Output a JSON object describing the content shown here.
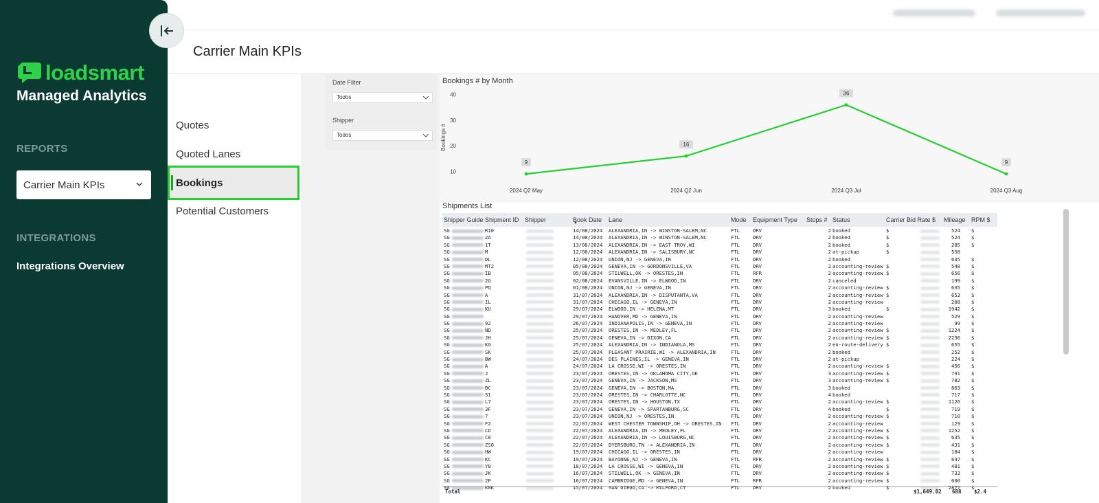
{
  "brand": {
    "name": "loadsmart",
    "subtitle": "Managed Analytics",
    "accent": "#2fd14a",
    "logo_icon": "loadsmart-logo-icon"
  },
  "sidebar": {
    "reports_title": "REPORTS",
    "selected_report": "Carrier Main KPIs",
    "integrations_title": "INTEGRATIONS",
    "integrations_link": "Integrations Overview",
    "collapse_icon": "collapse-left-icon"
  },
  "header": {
    "page_title": "Carrier Main KPIs"
  },
  "report_nav": {
    "items": [
      {
        "label": "Quotes",
        "active": false
      },
      {
        "label": "Quoted Lanes",
        "active": false
      },
      {
        "label": "Bookings",
        "active": true
      },
      {
        "label": "Potential Customers",
        "active": false
      }
    ]
  },
  "filters": {
    "date": {
      "label": "Date Filter",
      "value": "Todos"
    },
    "shipper": {
      "label": "Shipper",
      "value": "Todos"
    }
  },
  "chart_data": {
    "type": "line",
    "title": "Bookings # by Month",
    "ylabel": "Bookings #",
    "xlabel": "",
    "categories": [
      "2024 Q2 May",
      "2024 Q2 Jun",
      "2024 Q3 Jul",
      "2024 Q3 Aug"
    ],
    "values": [
      9,
      16,
      36,
      9
    ],
    "data_labels": [
      "9",
      "16",
      "36",
      "9"
    ],
    "yticks": [
      "10",
      "20",
      "30",
      "40"
    ],
    "ylim": [
      5,
      41
    ],
    "line_color": "#22d12f",
    "grid": false
  },
  "table": {
    "title": "Shipments List",
    "columns": [
      "Shipper Guide Shipment ID",
      "Shipper",
      "Book Date",
      "Lane",
      "Mode",
      "Equipment Type",
      "Stops #",
      "Status",
      "Carrier Bid Rate $",
      "Mileage",
      "RPM $"
    ],
    "rows": [
      [
        "SG",
        "R10",
        "14/08/2024",
        "ALEXANDRIA,IN -> WINSTON-SALEM,NC",
        "FTL",
        "DRV",
        "2",
        "booked",
        "$",
        "524",
        "$"
      ],
      [
        "SG",
        "2A",
        "14/08/2024",
        "ALEXANDRIA,IN -> WINSTON-SALEM,NC",
        "FTL",
        "DRV",
        "2",
        "booked",
        "$",
        "524",
        "$"
      ],
      [
        "SG",
        "1T",
        "13/08/2024",
        "ALEXANDRIA,IN -> EAST TROY,WI",
        "FTL",
        "DRV",
        "2",
        "booked",
        "$",
        "285",
        "$"
      ],
      [
        "SG",
        "M",
        "12/08/2024",
        "ALEXANDRIA,IN -> SALISBURY,NC",
        "FTL",
        "DRV",
        "2",
        "at-pickup",
        "$",
        "558",
        ""
      ],
      [
        "SG",
        "DL",
        "12/08/2024",
        "UNION,NJ -> GENEVA,IN",
        "FTL",
        "DRV",
        "2",
        "booked",
        "",
        "635",
        "$"
      ],
      [
        "SG",
        "MT2",
        "05/08/2024",
        "GENEVA,IN -> GORDONSVILLE,VA",
        "FTL",
        "DRV",
        "2",
        "accounting-review",
        "$",
        "548",
        "$"
      ],
      [
        "SG",
        "IB",
        "05/08/2024",
        "STILWELL,OK -> ORESTES,IN",
        "FTL",
        "RFR",
        "2",
        "accounting-review",
        "$",
        "656",
        "$"
      ],
      [
        "SG",
        "2G",
        "02/08/2024",
        "EVANSVILLE,IN -> ELWOOD,IN",
        "FTL",
        "DRV",
        "2",
        "canceled",
        "",
        "199",
        "$"
      ],
      [
        "SG",
        "PQ",
        "01/08/2024",
        "UNION,NJ -> GENEVA,IN",
        "FTL",
        "DRV",
        "2",
        "accounting-review",
        "$",
        "635",
        "$"
      ],
      [
        "SG",
        "A",
        "31/07/2024",
        "ALEXANDRIA,IN -> DISPUTANTA,VA",
        "FTL",
        "DRV",
        "2",
        "accounting-review",
        "$",
        "653",
        "$"
      ],
      [
        "SG",
        "IL",
        "31/07/2024",
        "CHICAGO,IL -> GENEVA,IN",
        "FTL",
        "DRV",
        "2",
        "accounting-review",
        "",
        "208",
        "$"
      ],
      [
        "SG",
        "KU",
        "29/07/2024",
        "ELWOOD,IN -> HELENA,MT",
        "FTL",
        "DRV",
        "3",
        "booked",
        "$",
        "1942",
        "$"
      ],
      [
        "SG",
        "",
        "29/07/2024",
        "HANOVER,MD -> GENEVA,IN",
        "FTL",
        "DRV",
        "2",
        "accounting-review",
        "",
        "529",
        "$"
      ],
      [
        "SG",
        "92",
        "26/07/2024",
        "INDIANAPOLIS,IN -> GENEVA,IN",
        "FTL",
        "DRV",
        "2",
        "accounting-review",
        "",
        "99",
        "$"
      ],
      [
        "SG",
        "ND",
        "25/07/2024",
        "ORESTES,IN -> MEDLEY,FL",
        "FTL",
        "DRV",
        "2",
        "accounting-review",
        "$",
        "1224",
        "$"
      ],
      [
        "SG",
        "JH",
        "25/07/2024",
        "GENEVA,IN -> DIXON,CA",
        "FTL",
        "DRV",
        "2",
        "accounting-review",
        "$",
        "2236",
        "$"
      ],
      [
        "SG",
        "KG",
        "25/07/2024",
        "ALEXANDRIA,IN -> INDIANOLA,MS",
        "FTL",
        "DRV",
        "2",
        "en-route-delivery",
        "$",
        "655",
        "$"
      ],
      [
        "SG",
        "SK",
        "25/07/2024",
        "PLEASANT PRAIRIE,WI -> ALEXANDRIA,IN",
        "FTL",
        "DRV",
        "2",
        "booked",
        "",
        "252",
        "$"
      ],
      [
        "SG",
        "BW",
        "24/07/2024",
        "DES PLAINES,IL -> GENEVA,IN",
        "FTL",
        "DRV",
        "2",
        "at-pickup",
        "",
        "224",
        "$"
      ],
      [
        "SG",
        "A",
        "24/07/2024",
        "LA CROSSE,WI -> ORESTES,IN",
        "FTL",
        "DRV",
        "2",
        "accounting-review",
        "$",
        "456",
        "$"
      ],
      [
        "SG",
        "J",
        "23/07/2024",
        "ORESTES,IN -> OKLAHOMA CITY,OK",
        "FTL",
        "DRV",
        "3",
        "accounting-review",
        "$",
        "791",
        "$"
      ],
      [
        "SG",
        "ZL",
        "23/07/2024",
        "GENEVA,IN -> JACKSON,MS",
        "FTL",
        "DRV",
        "3",
        "accounting-review",
        "$",
        "782",
        "$"
      ],
      [
        "SG",
        "BC",
        "23/07/2024",
        "GENEVA,IN -> BOSTON,MA",
        "FTL",
        "DRV",
        "3",
        "booked",
        "",
        "863",
        "$"
      ],
      [
        "SG",
        "31",
        "23/07/2024",
        "ORESTES,IN -> CHARLOTTE,NC",
        "FTL",
        "DRV",
        "4",
        "booked",
        "",
        "717",
        "$"
      ],
      [
        "SG",
        "L7",
        "23/07/2024",
        "ORESTES,IN -> HOUSTON,TX",
        "FTL",
        "DRV",
        "2",
        "accounting-review",
        "$",
        "1126",
        "$"
      ],
      [
        "SG",
        "3F",
        "23/07/2024",
        "GENEVA,IN -> SPARTANBURG,SC",
        "FTL",
        "DRV",
        "4",
        "booked",
        "$",
        "719",
        "$"
      ],
      [
        "SG",
        "7",
        "23/07/2024",
        "UNION,NJ -> ORESTES,IN",
        "FTL",
        "DRV",
        "2",
        "accounting-review",
        "$",
        "710",
        "$"
      ],
      [
        "SG",
        "F2",
        "22/07/2024",
        "WEST CHESTER TOWNSHIP,OH -> ORESTES,IN",
        "FTL",
        "DRV",
        "2",
        "accounting-review",
        "",
        "129",
        "$"
      ],
      [
        "SG",
        "CD",
        "22/07/2024",
        "ALEXANDRIA,IN -> MEDLEY,FL",
        "FTL",
        "DRV",
        "2",
        "accounting-review",
        "$",
        "1252",
        "$"
      ],
      [
        "SG",
        "C8",
        "22/07/2024",
        "ALEXANDRIA,IN -> LOUISBURG,NC",
        "FTL",
        "DRV",
        "2",
        "accounting-review",
        "$",
        "635",
        "$"
      ],
      [
        "SG",
        "ZSO",
        "22/07/2024",
        "DYERSBURG,TN -> ALEXANDRIA,IN",
        "FTL",
        "DRV",
        "2",
        "accounting-review",
        "$",
        "431",
        "$"
      ],
      [
        "SG",
        "HW",
        "19/07/2024",
        "CHICAGO,IL -> ORESTES,IN",
        "FTL",
        "DRV",
        "2",
        "accounting-review",
        "",
        "184",
        "$"
      ],
      [
        "SG",
        "KC",
        "19/07/2024",
        "BAYONNE,NJ -> GENEVA,IN",
        "FTL",
        "RFR",
        "2",
        "accounting-review",
        "$",
        "647",
        "$"
      ],
      [
        "SG",
        "Y8",
        "18/07/2024",
        "LA CROSSE,WI -> GENEVA,IN",
        "FTL",
        "DRV",
        "2",
        "accounting-review",
        "$",
        "481",
        "$"
      ],
      [
        "SG",
        "JK",
        "16/07/2024",
        "STILWELL,OK -> GENEVA,IN",
        "FTL",
        "DRV",
        "2",
        "accounting-review",
        "$",
        "733",
        "$"
      ],
      [
        "SG",
        "2P",
        "16/07/2024",
        "CAMBRIDGE,MD -> GENEVA,IN",
        "FTL",
        "RFR",
        "2",
        "accounting-review",
        "$",
        "600",
        "$"
      ],
      [
        "SG",
        "KNK",
        "15/07/2024",
        "SAN DIEGO,CA -> MILFORD,CT",
        "FTL",
        "DRV",
        "2",
        "booked",
        "$",
        "2877",
        "$"
      ]
    ],
    "totals": {
      "label": "Total",
      "bid_rate": "$1,649.02",
      "mileage": "688",
      "rpm": "$2.4"
    }
  }
}
